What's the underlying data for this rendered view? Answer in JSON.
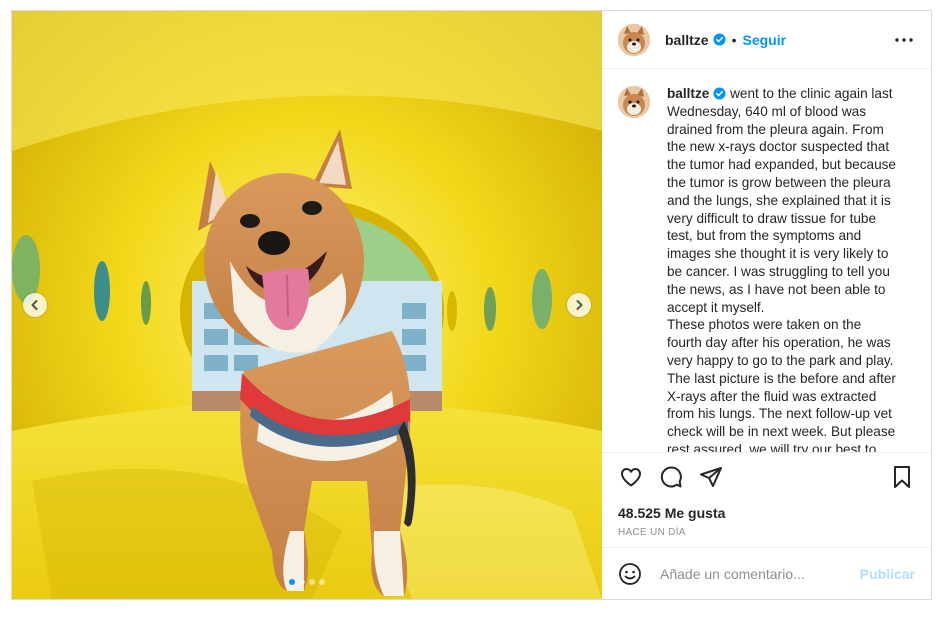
{
  "post": {
    "username": "balltze",
    "verified": true,
    "separator": "•",
    "follow_label": "Seguir",
    "more_icon": "more-horizontal-icon",
    "caption_paragraphs": [
      "went to the clinic again last Wednesday, 640 ml of blood was drained from the pleura again. From the new x-rays doctor suspected that the tumor had expanded, but because the tumor is grow between the pleura and the lungs, she explained that it is very difficult to draw tissue for tube test, but from the symptoms and images she thought it is very likely to be cancer. I was struggling to tell you the news, as I have not been able to accept it myself.",
      "These photos were taken on the fourth day after his operation, he was very happy to go to the park and play. The last picture is the before and after X-rays after the fluid was extracted from his lungs. The next follow-up vet check will be in next week. But please rest assured, we will try our best to"
    ],
    "likes": "48.525 Me gusta",
    "timestamp": "HACE UN DÍA",
    "comment_placeholder": "Añade un comentario...",
    "publish_label": "Publicar",
    "carousel": {
      "dots": 4,
      "active_index": 0
    }
  },
  "colors": {
    "accent": "#0095f6",
    "publish_disabled": "#b2dffc",
    "border": "#dbdbdb",
    "muted": "#8e8e8e",
    "tube_yellow": "#e9c800"
  },
  "icons": [
    "chevron-left-icon",
    "chevron-right-icon",
    "heart-icon",
    "comment-icon",
    "share-icon",
    "bookmark-icon",
    "emoji-icon",
    "verified-icon"
  ]
}
